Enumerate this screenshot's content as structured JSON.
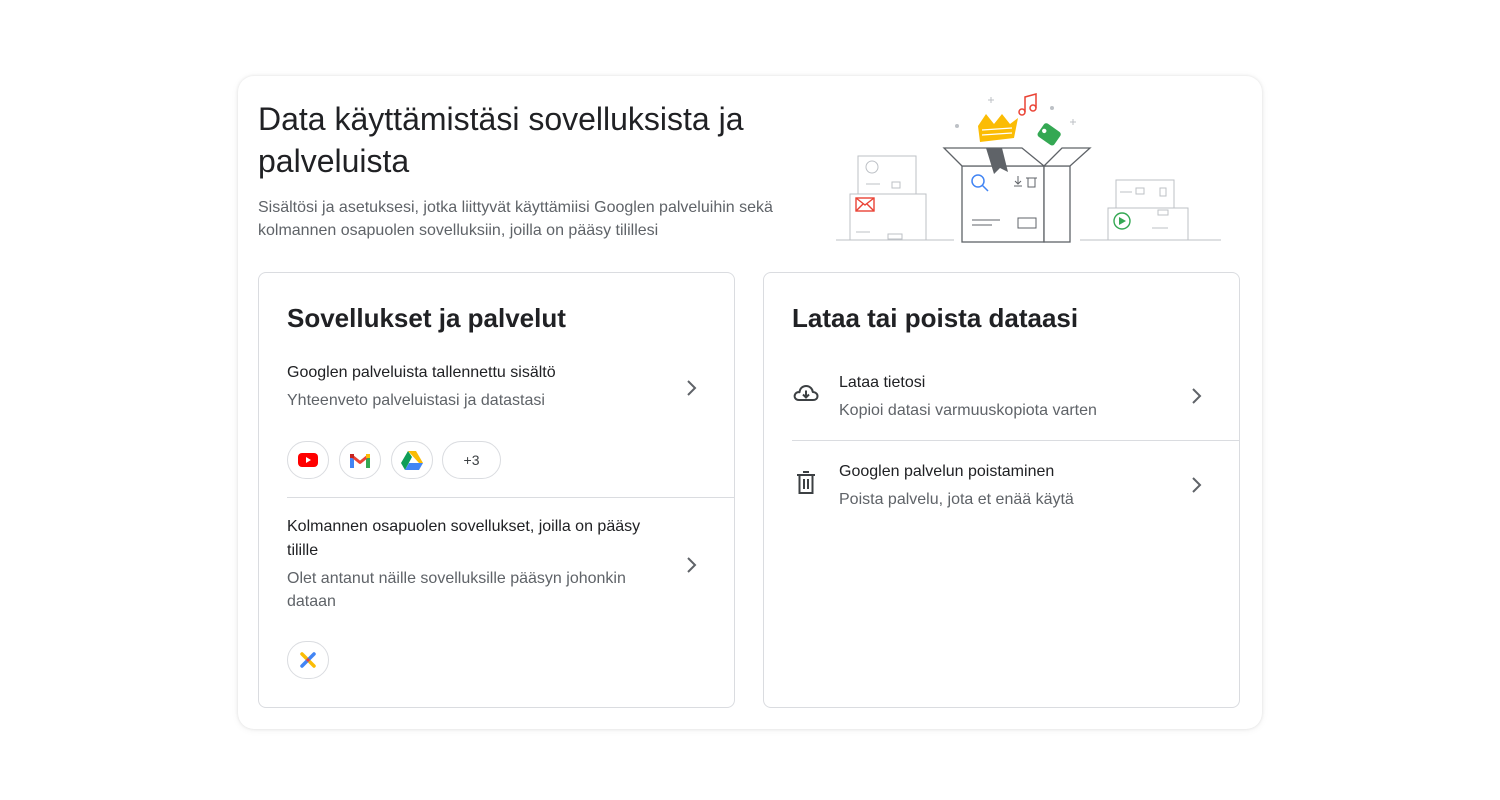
{
  "header": {
    "title": "Data käyttämistäsi sovelluksista ja palveluista",
    "description": "Sisältösi ja asetuksesi, jotka liittyvät käyttämiisi Googlen palveluihin sekä kolmannen osapuolen sovelluksiin, joilla on pääsy tilillesi"
  },
  "apps_card": {
    "title": "Sovellukset ja palvelut",
    "saved_content": {
      "title": "Googlen palveluista tallennettu sisältö",
      "subtitle": "Yhteenveto palveluistasi ja datastasi",
      "chips": [
        "youtube-icon",
        "gmail-icon",
        "drive-icon"
      ],
      "more_label": "+3"
    },
    "third_party": {
      "title": "Kolmannen osapuolen sovellukset, joilla on pääsy tilille",
      "subtitle": "Olet antanut näille sovelluksille pääsyn johonkin dataan",
      "chips": [
        "third-party-app-icon"
      ]
    }
  },
  "data_card": {
    "title": "Lataa tai poista dataasi",
    "download": {
      "icon": "cloud-download-icon",
      "title": "Lataa tietosi",
      "subtitle": "Kopioi datasi varmuuskopiota varten"
    },
    "delete_service": {
      "icon": "trash-icon",
      "title": "Googlen palvelun poistaminen",
      "subtitle": "Poista palvelu, jota et enää käytä"
    }
  },
  "colors": {
    "youtube_red": "#ff0000",
    "gmail_red": "#ea4335",
    "google_blue": "#4285f4",
    "google_green": "#34a853",
    "google_yellow": "#fbbc04",
    "text_secondary": "#5f6368",
    "divider": "#dadce0"
  }
}
